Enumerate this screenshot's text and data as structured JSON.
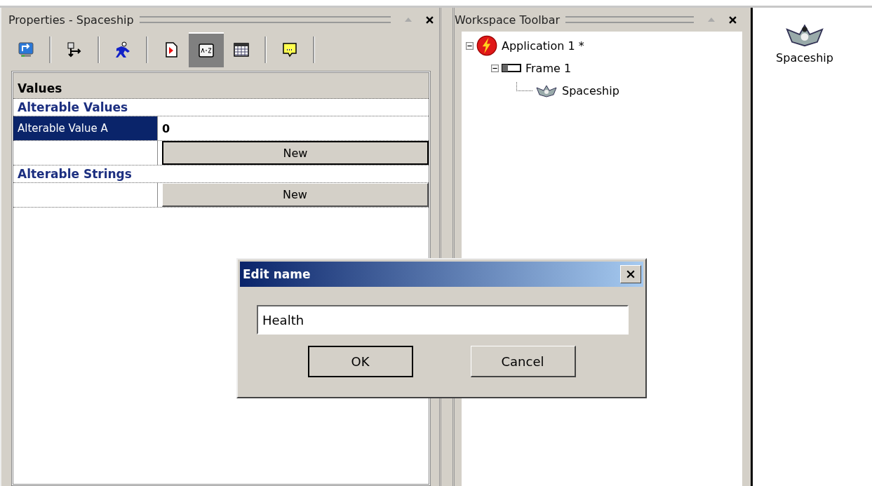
{
  "properties_panel": {
    "title": "Properties - Spaceship",
    "tools": [
      {
        "kind": "display",
        "selected": false
      },
      {
        "kind": "move",
        "selected": false
      },
      {
        "kind": "runner",
        "selected": false
      },
      {
        "kind": "document",
        "selected": false
      },
      {
        "kind": "sort",
        "selected": true
      },
      {
        "kind": "table",
        "selected": false
      },
      {
        "kind": "note",
        "selected": false
      }
    ],
    "grid": {
      "header": "Values",
      "sections": [
        {
          "title": "Alterable Values",
          "rows": [
            {
              "label": "Alterable Value A",
              "value": "0",
              "selected": true
            }
          ],
          "button": "New"
        },
        {
          "title": "Alterable Strings",
          "button": "New"
        }
      ]
    }
  },
  "workspace_panel": {
    "title": "Workspace Toolbar",
    "tree": [
      {
        "label": "Application 1 *",
        "kind": "application",
        "expanded": true,
        "children": [
          {
            "label": "Frame 1",
            "kind": "frame",
            "expanded": true,
            "children": [
              {
                "label": "Spaceship",
                "kind": "object"
              }
            ]
          }
        ]
      }
    ]
  },
  "frame_view": {
    "objects": [
      {
        "label": "Spaceship"
      }
    ]
  },
  "dialog": {
    "title": "Edit name",
    "field_value": "Health",
    "buttons": [
      {
        "label": "OK",
        "default": true
      },
      {
        "label": "Cancel",
        "default": false
      }
    ]
  }
}
